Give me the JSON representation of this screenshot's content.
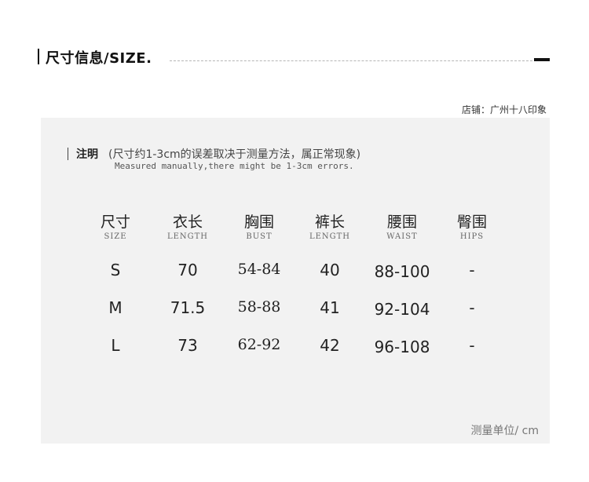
{
  "header": {
    "title": "尺寸信息/SIZE."
  },
  "shop": {
    "label": "店铺：广州十八印象"
  },
  "note": {
    "title": "注明",
    "text": "(尺寸约1-3cm的误差取决于测量方法，属正常现象)",
    "english": "Measured manually,there might be 1-3cm errors."
  },
  "table": {
    "columns": [
      {
        "zh": "尺寸",
        "en": "SIZE"
      },
      {
        "zh": "衣长",
        "en": "LENGTH"
      },
      {
        "zh": "胸围",
        "en": "BUST"
      },
      {
        "zh": "裤长",
        "en": "LENGTH"
      },
      {
        "zh": "腰围",
        "en": "WAIST"
      },
      {
        "zh": "臀围",
        "en": "HIPS"
      }
    ],
    "rows": [
      [
        "S",
        "70",
        "54-84",
        "40",
        "88-100",
        "-"
      ],
      [
        "M",
        "71.5",
        "58-88",
        "41",
        "92-104",
        "-"
      ],
      [
        "L",
        "73",
        "62-92",
        "42",
        "96-108",
        "-"
      ]
    ]
  },
  "unit": "测量单位/ cm"
}
